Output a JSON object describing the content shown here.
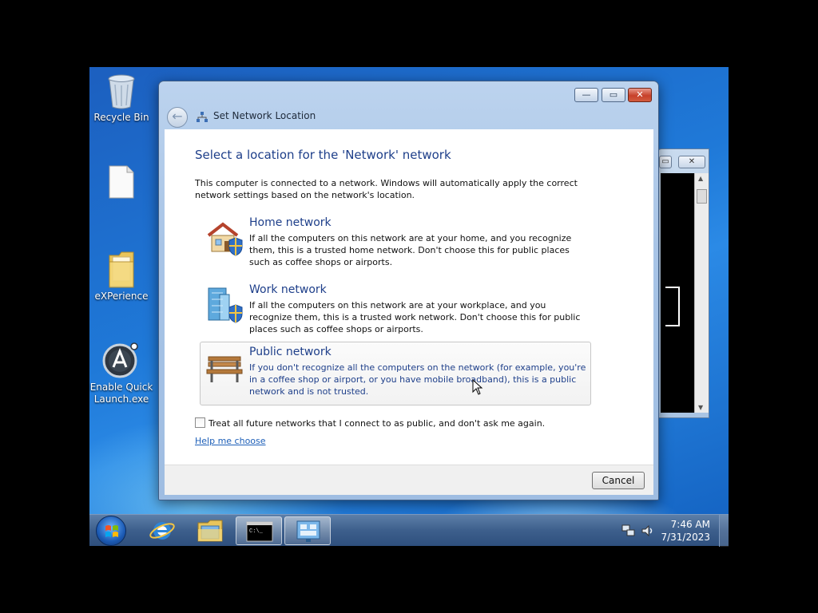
{
  "desktop": {
    "icons": [
      {
        "label": "Recycle Bin"
      },
      {
        "label": ""
      },
      {
        "label": "eXPerience"
      },
      {
        "label": "Enable Quick Launch.exe"
      }
    ]
  },
  "dialog": {
    "title": "Set Network Location",
    "heading": "Select a location for the 'Network' network",
    "intro": "This computer is connected to a network. Windows will automatically apply the correct network settings based on the network's location.",
    "options": [
      {
        "title": "Home network",
        "description": "If all the computers on this network are at your home, and you recognize them, this is a trusted home network.  Don't choose this for public places such as coffee shops or airports."
      },
      {
        "title": "Work network",
        "description": "If all the computers on this network are at your workplace, and you recognize them, this is a trusted work network.  Don't choose this for public places such as coffee shops or airports."
      },
      {
        "title": "Public network",
        "description": "If you don't recognize all the computers on the network (for example, you're in a coffee shop or airport, or you have mobile broadband), this is a public network and is not trusted."
      }
    ],
    "checkbox_label": "Treat all future networks that I connect to as public, and don't ask me again.",
    "checkbox_checked": false,
    "help_link": "Help me choose",
    "cancel_label": "Cancel"
  },
  "taskbar": {
    "time": "7:46 AM",
    "date": "7/31/2023",
    "pinned": [
      "internet-explorer",
      "file-explorer",
      "command-prompt",
      "network-settings"
    ]
  },
  "colors": {
    "heading": "#1e3f8a",
    "link": "#1d5fb8",
    "desktop": "#1f79d8"
  }
}
